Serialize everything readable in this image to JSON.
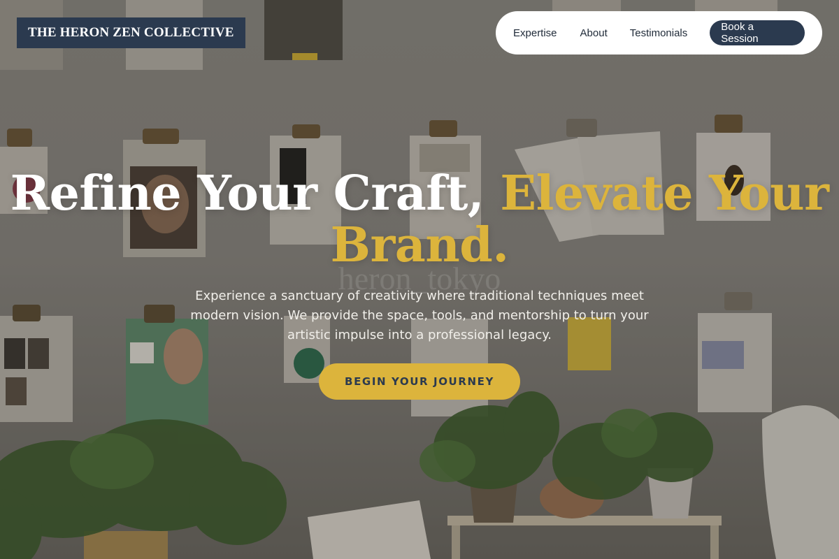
{
  "brand": {
    "name": "THE HERON ZEN COLLECTIVE"
  },
  "nav": {
    "items": [
      "Expertise",
      "About",
      "Testimonials"
    ],
    "cta": "Book a Session"
  },
  "hero": {
    "headline_main": "Refine Your Craft,",
    "headline_accent": "Elevate Your Brand.",
    "ghost_text": "heron_tokyo",
    "subtitle": "Experience a sanctuary of creativity where traditional techniques meet modern vision. We provide the space, tools, and mentorship to turn your artistic impulse into a professional legacy.",
    "cta": "BEGIN YOUR JOURNEY"
  },
  "colors": {
    "primary": "#2b3a4f",
    "accent": "#dcb43c",
    "white": "#ffffff"
  }
}
